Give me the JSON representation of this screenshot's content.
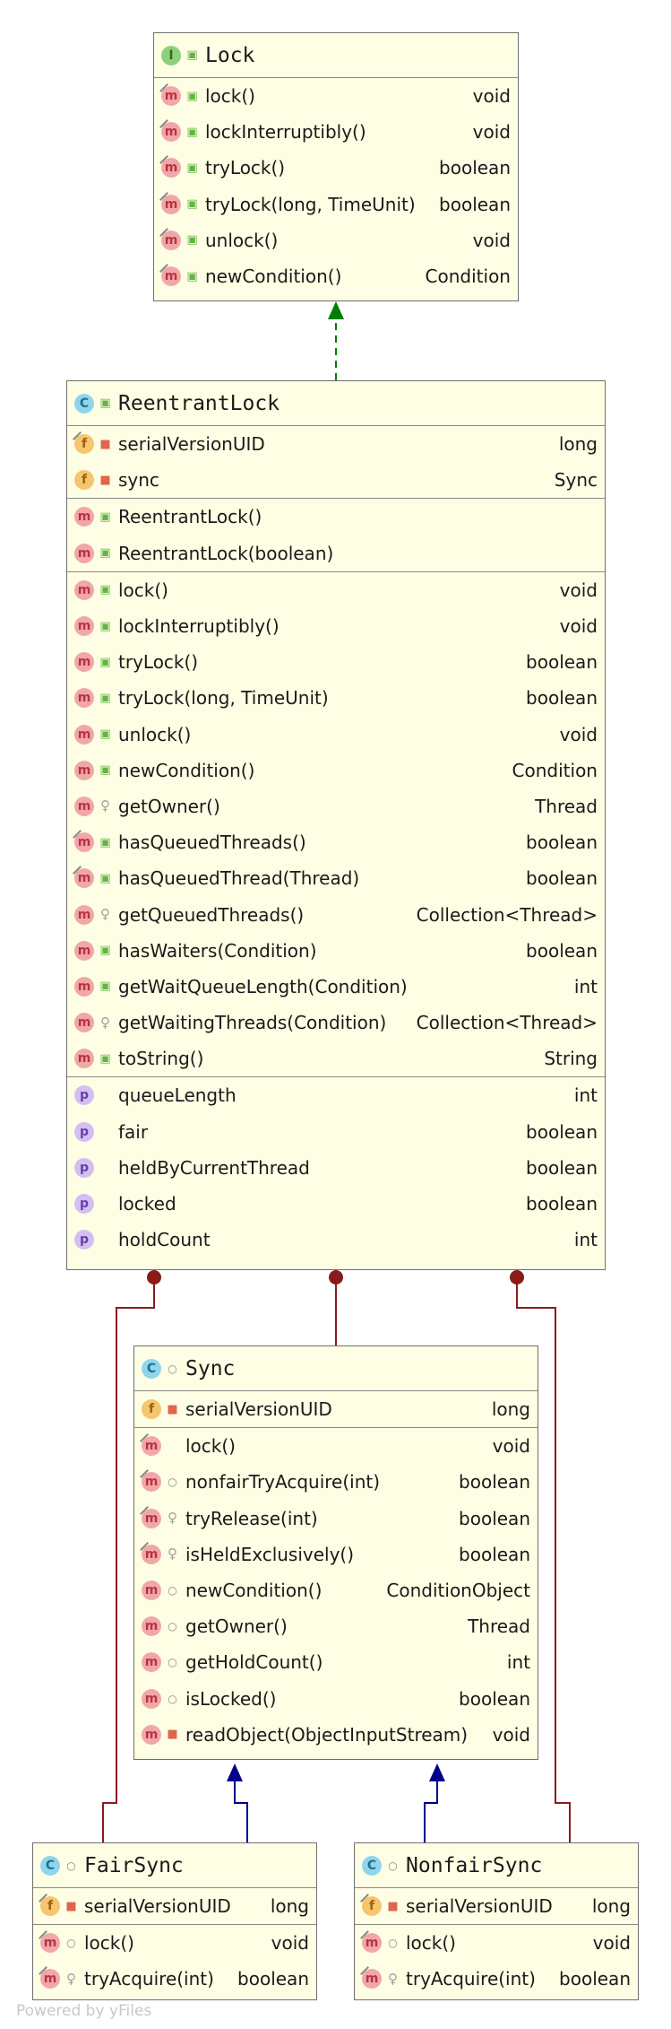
{
  "classes": {
    "lock": {
      "kind": "interface",
      "badge": "I",
      "visibility": "public",
      "name": "Lock",
      "sections": [
        [
          {
            "badge": "m",
            "abstract": true,
            "vis": "public",
            "name": "lock()",
            "type": "void"
          },
          {
            "badge": "m",
            "abstract": true,
            "vis": "public",
            "name": "lockInterruptibly()",
            "type": "void"
          },
          {
            "badge": "m",
            "abstract": true,
            "vis": "public",
            "name": "tryLock()",
            "type": "boolean"
          },
          {
            "badge": "m",
            "abstract": true,
            "vis": "public",
            "name": "tryLock(long, TimeUnit)",
            "type": "boolean"
          },
          {
            "badge": "m",
            "abstract": true,
            "vis": "public",
            "name": "unlock()",
            "type": "void"
          },
          {
            "badge": "m",
            "abstract": true,
            "vis": "public",
            "name": "newCondition()",
            "type": "Condition"
          }
        ]
      ]
    },
    "reentrantlock": {
      "kind": "class",
      "badge": "C",
      "visibility": "public",
      "name": "ReentrantLock",
      "sections": [
        [
          {
            "badge": "f",
            "abstract": true,
            "vis": "private",
            "name": "serialVersionUID",
            "type": "long"
          },
          {
            "badge": "f",
            "abstract": false,
            "vis": "private",
            "name": "sync",
            "type": "Sync"
          }
        ],
        [
          {
            "badge": "m",
            "abstract": false,
            "vis": "public",
            "name": "ReentrantLock()",
            "type": ""
          },
          {
            "badge": "m",
            "abstract": false,
            "vis": "public",
            "name": "ReentrantLock(boolean)",
            "type": ""
          }
        ],
        [
          {
            "badge": "m",
            "abstract": false,
            "vis": "public",
            "name": "lock()",
            "type": "void"
          },
          {
            "badge": "m",
            "abstract": false,
            "vis": "public",
            "name": "lockInterruptibly()",
            "type": "void"
          },
          {
            "badge": "m",
            "abstract": false,
            "vis": "public",
            "name": "tryLock()",
            "type": "boolean"
          },
          {
            "badge": "m",
            "abstract": false,
            "vis": "public",
            "name": "tryLock(long, TimeUnit)",
            "type": "boolean"
          },
          {
            "badge": "m",
            "abstract": false,
            "vis": "public",
            "name": "unlock()",
            "type": "void"
          },
          {
            "badge": "m",
            "abstract": false,
            "vis": "public",
            "name": "newCondition()",
            "type": "Condition"
          },
          {
            "badge": "m",
            "abstract": false,
            "vis": "protected",
            "name": "getOwner()",
            "type": "Thread"
          },
          {
            "badge": "m",
            "abstract": true,
            "vis": "public",
            "name": "hasQueuedThreads()",
            "type": "boolean"
          },
          {
            "badge": "m",
            "abstract": true,
            "vis": "public",
            "name": "hasQueuedThread(Thread)",
            "type": "boolean"
          },
          {
            "badge": "m",
            "abstract": false,
            "vis": "protected",
            "name": "getQueuedThreads()",
            "type": "Collection<Thread>"
          },
          {
            "badge": "m",
            "abstract": false,
            "vis": "public",
            "name": "hasWaiters(Condition)",
            "type": "boolean"
          },
          {
            "badge": "m",
            "abstract": false,
            "vis": "public",
            "name": "getWaitQueueLength(Condition)",
            "type": "int"
          },
          {
            "badge": "m",
            "abstract": false,
            "vis": "protected",
            "name": "getWaitingThreads(Condition)",
            "type": "Collection<Thread>"
          },
          {
            "badge": "m",
            "abstract": false,
            "vis": "public",
            "name": "toString()",
            "type": "String"
          }
        ],
        [
          {
            "badge": "p",
            "abstract": false,
            "vis": "none",
            "name": "queueLength",
            "type": "int"
          },
          {
            "badge": "p",
            "abstract": false,
            "vis": "none",
            "name": "fair",
            "type": "boolean"
          },
          {
            "badge": "p",
            "abstract": false,
            "vis": "none",
            "name": "heldByCurrentThread",
            "type": "boolean"
          },
          {
            "badge": "p",
            "abstract": false,
            "vis": "none",
            "name": "locked",
            "type": "boolean"
          },
          {
            "badge": "p",
            "abstract": false,
            "vis": "none",
            "name": "holdCount",
            "type": "int"
          }
        ]
      ]
    },
    "sync": {
      "kind": "abstract-class",
      "badge": "C",
      "visibility": "package",
      "name": "Sync",
      "sections": [
        [
          {
            "badge": "f",
            "abstract": false,
            "vis": "private",
            "name": "serialVersionUID",
            "type": "long"
          }
        ],
        [
          {
            "badge": "m",
            "abstract": true,
            "vis": "none",
            "name": "lock()",
            "type": "void"
          },
          {
            "badge": "m",
            "abstract": true,
            "vis": "package",
            "name": "nonfairTryAcquire(int)",
            "type": "boolean"
          },
          {
            "badge": "m",
            "abstract": true,
            "vis": "protected",
            "name": "tryRelease(int)",
            "type": "boolean"
          },
          {
            "badge": "m",
            "abstract": true,
            "vis": "protected",
            "name": "isHeldExclusively()",
            "type": "boolean"
          },
          {
            "badge": "m",
            "abstract": false,
            "vis": "package",
            "name": "newCondition()",
            "type": "ConditionObject"
          },
          {
            "badge": "m",
            "abstract": false,
            "vis": "package",
            "name": "getOwner()",
            "type": "Thread"
          },
          {
            "badge": "m",
            "abstract": false,
            "vis": "package",
            "name": "getHoldCount()",
            "type": "int"
          },
          {
            "badge": "m",
            "abstract": false,
            "vis": "package",
            "name": "isLocked()",
            "type": "boolean"
          },
          {
            "badge": "m",
            "abstract": false,
            "vis": "private",
            "name": "readObject(ObjectInputStream)",
            "type": "void"
          }
        ]
      ]
    },
    "fairsync": {
      "kind": "class",
      "badge": "C",
      "visibility": "package",
      "name": "FairSync",
      "sections": [
        [
          {
            "badge": "f",
            "abstract": true,
            "vis": "private",
            "name": "serialVersionUID",
            "type": "long"
          }
        ],
        [
          {
            "badge": "m",
            "abstract": true,
            "vis": "package",
            "name": "lock()",
            "type": "void"
          },
          {
            "badge": "m",
            "abstract": true,
            "vis": "protected",
            "name": "tryAcquire(int)",
            "type": "boolean"
          }
        ]
      ]
    },
    "nonfairsync": {
      "kind": "class",
      "badge": "C",
      "visibility": "package",
      "name": "NonfairSync",
      "sections": [
        [
          {
            "badge": "f",
            "abstract": true,
            "vis": "private",
            "name": "serialVersionUID",
            "type": "long"
          }
        ],
        [
          {
            "badge": "m",
            "abstract": true,
            "vis": "package",
            "name": "lock()",
            "type": "void"
          },
          {
            "badge": "m",
            "abstract": true,
            "vis": "protected",
            "name": "tryAcquire(int)",
            "type": "boolean"
          }
        ]
      ]
    }
  },
  "relations": [
    {
      "type": "implements",
      "from": "reentrantlock",
      "to": "lock",
      "color": "#008000"
    },
    {
      "type": "inner-class",
      "from": "reentrantlock",
      "to": "sync",
      "color": "#8b1a1a"
    },
    {
      "type": "inner-class",
      "from": "reentrantlock",
      "to": "fairsync",
      "color": "#8b1a1a"
    },
    {
      "type": "inner-class",
      "from": "reentrantlock",
      "to": "nonfairsync",
      "color": "#8b1a1a"
    },
    {
      "type": "extends",
      "from": "fairsync",
      "to": "sync",
      "color": "#00008b"
    },
    {
      "type": "extends",
      "from": "nonfairsync",
      "to": "sync",
      "color": "#00008b"
    }
  ],
  "watermark": "Powered by yFiles"
}
